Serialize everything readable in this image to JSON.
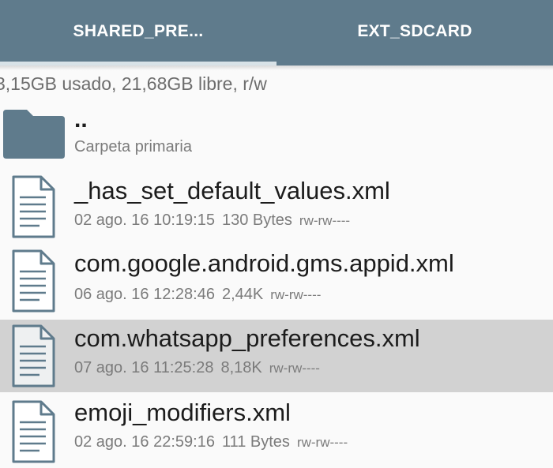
{
  "tabs": [
    {
      "label": "SHARED_PRE...",
      "active": true
    },
    {
      "label": "EXT_SDCARD",
      "active": false
    }
  ],
  "storage_info": "3,15GB usado, 21,68GB libre, r/w",
  "parent_entry": {
    "name": "..",
    "subtitle": "Carpeta primaria",
    "icon": "folder-icon"
  },
  "files": [
    {
      "name": "_has_set_default_values.xml",
      "date": "02 ago. 16 10:19:15",
      "size": "130 Bytes",
      "permissions": "rw-rw----",
      "icon": "document-icon",
      "selected": false
    },
    {
      "name": "com.google.android.gms.appid.xml",
      "date": "06 ago. 16 12:28:46",
      "size": "2,44K",
      "permissions": "rw-rw----",
      "icon": "document-icon",
      "selected": false
    },
    {
      "name": "com.whatsapp_preferences.xml",
      "date": "07 ago. 16 11:25:28",
      "size": "8,18K",
      "permissions": "rw-rw----",
      "icon": "document-icon",
      "selected": true
    },
    {
      "name": "emoji_modifiers.xml",
      "date": "02 ago. 16 22:59:16",
      "size": "111 Bytes",
      "permissions": "rw-rw----",
      "icon": "document-icon",
      "selected": false
    }
  ],
  "colors": {
    "toolbar": "#5f7b8c",
    "icon": "#5f7b8c",
    "selected_row": "#d2d2d2",
    "tab_indicator": "#d8e2e7"
  }
}
